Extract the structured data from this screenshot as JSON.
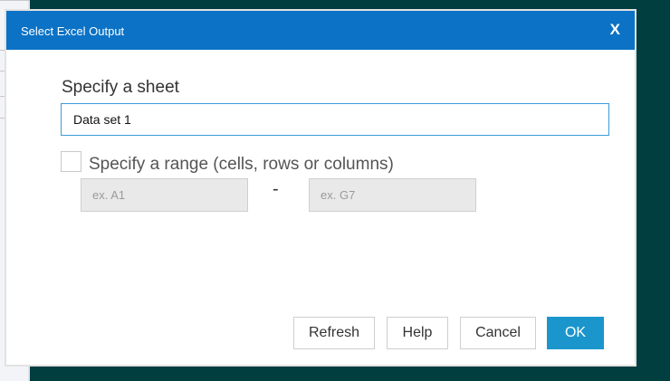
{
  "dialog": {
    "title": "Select Excel Output",
    "close_label": "X"
  },
  "sheet": {
    "label": "Specify a sheet",
    "value": "Data set 1"
  },
  "range": {
    "label": "Specify a range (cells, rows or columns)",
    "checked": false,
    "from_placeholder": "ex. A1",
    "to_placeholder": "ex. G7",
    "separator": "-"
  },
  "buttons": {
    "refresh": "Refresh",
    "help": "Help",
    "cancel": "Cancel",
    "ok": "OK"
  },
  "colors": {
    "titlebar": "#0b72c6",
    "ok": "#1a96cc",
    "background": "#003e40"
  }
}
